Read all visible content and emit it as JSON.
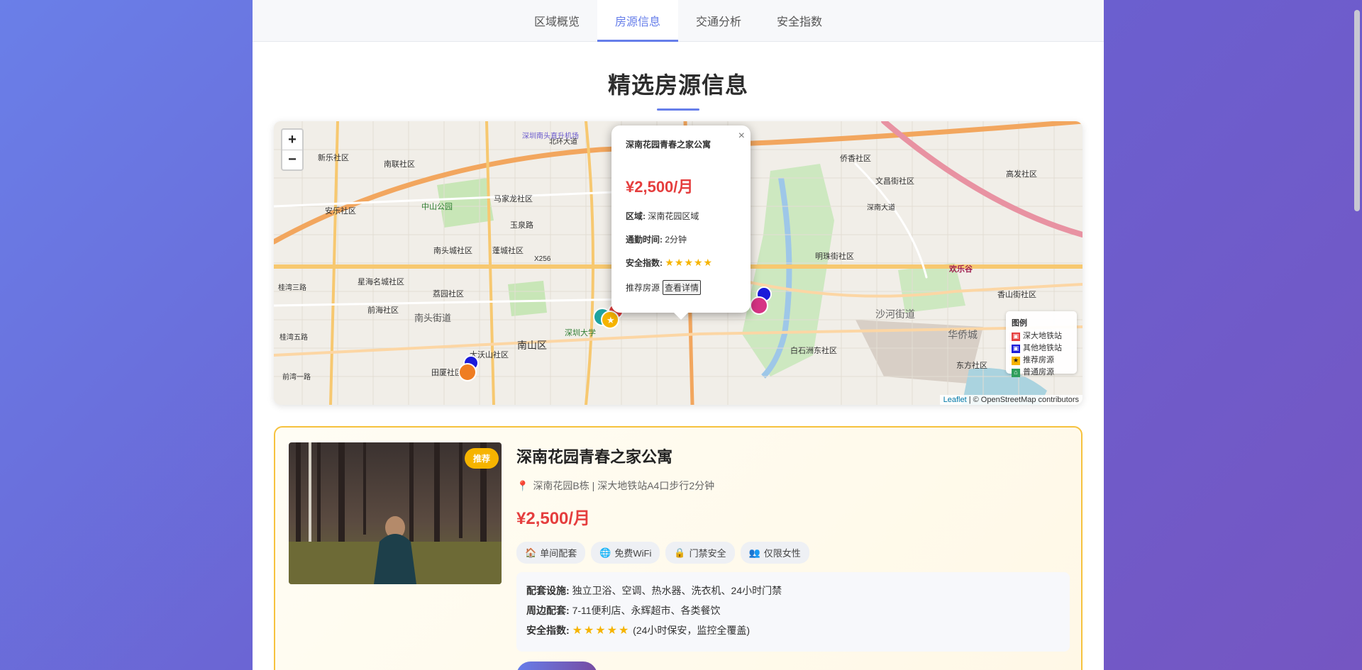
{
  "tabs": [
    {
      "label": "区域概览"
    },
    {
      "label": "房源信息"
    },
    {
      "label": "交通分析"
    },
    {
      "label": "安全指数"
    }
  ],
  "active_tab": "房源信息",
  "section_title": "精选房源信息",
  "map": {
    "zoom_in": "+",
    "zoom_out": "−",
    "place_labels": [
      "新乐社区",
      "南联社区",
      "安乐社区",
      "中山公园",
      "马家龙社区",
      "玉泉路",
      "南头城社区",
      "蓬城社区",
      "星海名城社区",
      "南头街道",
      "荔园社区",
      "南山区",
      "深圳大学",
      "大沃山社区",
      "田厦社区",
      "北环大道",
      "深南大道",
      "沙河街道",
      "华侨城",
      "香山街社区",
      "明珠街社区",
      "白石洲东社区",
      "东方社区",
      "欢乐谷",
      "文昌街社区",
      "高发社区",
      "侨香社区",
      "X256",
      "深圳南头直升机场",
      "桂湾三路",
      "前海社区",
      "桂湾五路",
      "前湾一路"
    ],
    "popup": {
      "close": "×",
      "title": "深南花园青春之家公寓",
      "price": "¥2,500/月",
      "area_label": "区域:",
      "area_value": "深南花园区域",
      "commute_label": "通勤时间:",
      "commute_value": "2分钟",
      "safety_label": "安全指数:",
      "safety_stars": "★★★★★",
      "footer_text": "推荐房源",
      "detail_button": "查看详情"
    },
    "legend": {
      "title": "图例",
      "items": [
        {
          "label": "深大地铁站",
          "color": "#e53e3e"
        },
        {
          "label": "其他地铁站",
          "color": "#1a1ad9"
        },
        {
          "label": "推荐房源",
          "color": "#f6b400"
        },
        {
          "label": "普通房源",
          "color": "#2e9e5b"
        }
      ]
    },
    "attribution_leaflet": "Leaflet",
    "attribution_rest": "| © OpenStreetMap contributors"
  },
  "listing": {
    "badge": "推荐",
    "title": "深南花园青春之家公寓",
    "address": "深南花园B栋 | 深大地铁站A4口步行2分钟",
    "price": "¥2,500/月",
    "tags": [
      {
        "icon": "house-icon",
        "label": "单间配套"
      },
      {
        "icon": "globe-icon",
        "label": "免费WiFi"
      },
      {
        "icon": "lock-icon",
        "label": "门禁安全"
      },
      {
        "icon": "people-icon",
        "label": "仅限女性"
      }
    ],
    "facilities_label": "配套设施:",
    "facilities_value": "独立卫浴、空调、热水器、洗衣机、24小时门禁",
    "surroundings_label": "周边配套:",
    "surroundings_value": "7-11便利店、永辉超市、各类餐饮",
    "safety_label": "安全指数:",
    "safety_stars": "★★★★★",
    "safety_note": "(24小时保安，监控全覆盖)"
  }
}
